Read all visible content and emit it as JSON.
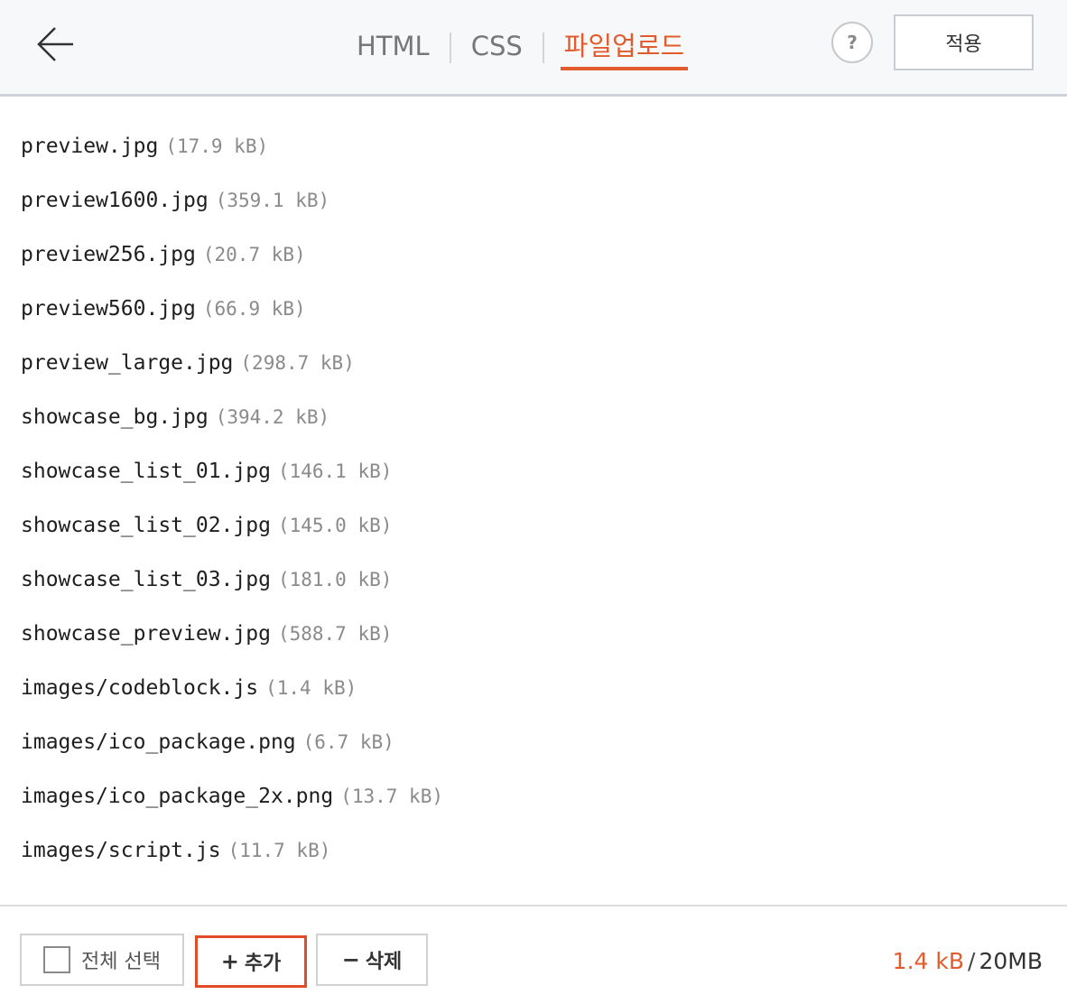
{
  "header": {
    "tabs": [
      {
        "label": "HTML",
        "active": false
      },
      {
        "label": "CSS",
        "active": false
      },
      {
        "label": "파일업로드",
        "active": true
      }
    ],
    "help_label": "?",
    "apply_label": "적용"
  },
  "files": [
    {
      "name": "preview.jpg",
      "size": "(17.9 kB)"
    },
    {
      "name": "preview1600.jpg",
      "size": "(359.1 kB)"
    },
    {
      "name": "preview256.jpg",
      "size": "(20.7 kB)"
    },
    {
      "name": "preview560.jpg",
      "size": "(66.9 kB)"
    },
    {
      "name": "preview_large.jpg",
      "size": "(298.7 kB)"
    },
    {
      "name": "showcase_bg.jpg",
      "size": "(394.2 kB)"
    },
    {
      "name": "showcase_list_01.jpg",
      "size": "(146.1 kB)"
    },
    {
      "name": "showcase_list_02.jpg",
      "size": "(145.0 kB)"
    },
    {
      "name": "showcase_list_03.jpg",
      "size": "(181.0 kB)"
    },
    {
      "name": "showcase_preview.jpg",
      "size": "(588.7 kB)"
    },
    {
      "name": "images/codeblock.js",
      "size": "(1.4 kB)"
    },
    {
      "name": "images/ico_package.png",
      "size": "(6.7 kB)"
    },
    {
      "name": "images/ico_package_2x.png",
      "size": "(13.7 kB)"
    },
    {
      "name": "images/script.js",
      "size": "(11.7 kB)"
    }
  ],
  "footer": {
    "select_all_label": "전체 선택",
    "add_symbol": "+",
    "add_label": "추가",
    "delete_symbol": "−",
    "delete_label": "삭제",
    "usage_used": "1.4 kB",
    "usage_separator": "/",
    "usage_limit": "20MB"
  },
  "colors": {
    "accent": "#e25b2d",
    "highlight_border": "#e24b26"
  },
  "icons": {
    "back": "arrow-left-icon",
    "help": "question-icon",
    "checkbox": "checkbox-icon"
  }
}
